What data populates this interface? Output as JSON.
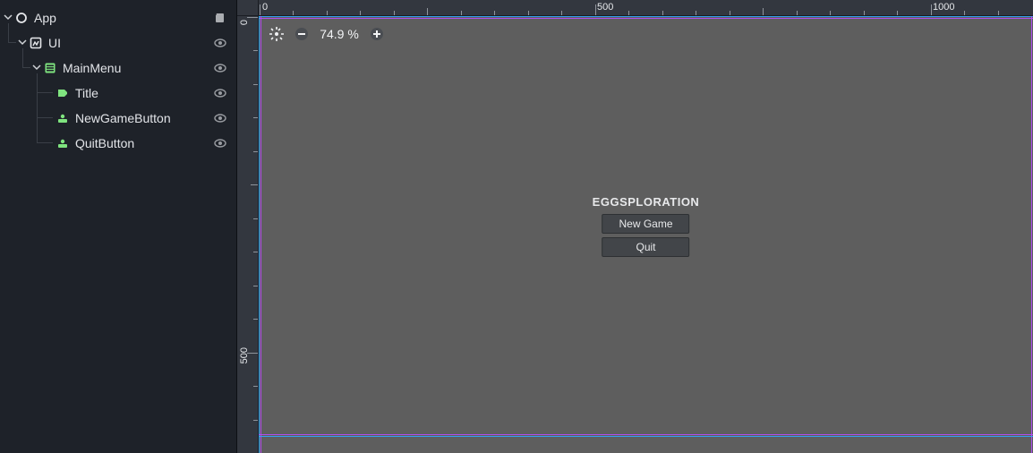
{
  "scene_tree": {
    "root": {
      "name": "App",
      "script_attached": true,
      "children": [
        {
          "name": "UI",
          "visibility_toggle": true,
          "children": [
            {
              "name": "MainMenu",
              "visibility_toggle": true,
              "children": [
                {
                  "name": "Title",
                  "visibility_toggle": true
                },
                {
                  "name": "NewGameButton",
                  "visibility_toggle": true
                },
                {
                  "name": "QuitButton",
                  "visibility_toggle": true
                }
              ]
            }
          ]
        }
      ]
    }
  },
  "viewport": {
    "zoom_label": "74.9 %",
    "ruler_top": [
      "0",
      "500",
      "1000"
    ],
    "ruler_left": [
      "0",
      "500"
    ]
  },
  "preview": {
    "title": "EGGSPLORATION",
    "new_game_label": "New Game",
    "quit_label": "Quit"
  }
}
